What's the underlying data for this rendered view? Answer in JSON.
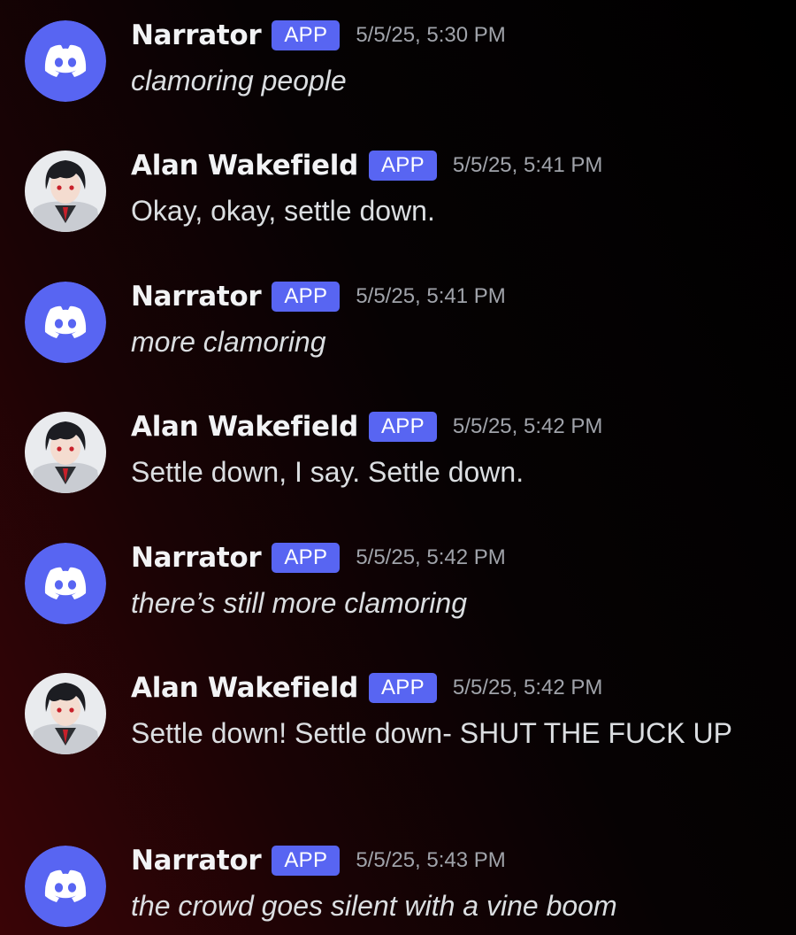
{
  "colors": {
    "badge": "#5865f2",
    "discord_avatar_bg": "#5865f2",
    "timestamp": "#a0a3aa",
    "message_text": "#dbdee1"
  },
  "messages": [
    {
      "username": "Narrator",
      "badge": "APP",
      "timestamp": "5/5/25, 5:30 PM",
      "text": "clamoring people",
      "italic": true,
      "avatar": "discord-logo-icon"
    },
    {
      "username": "Alan Wakefield",
      "badge": "APP",
      "timestamp": "5/5/25, 5:41 PM",
      "text": "Okay, okay, settle down.",
      "italic": false,
      "avatar": "anime-character-avatar"
    },
    {
      "username": "Narrator",
      "badge": "APP",
      "timestamp": "5/5/25, 5:41 PM",
      "text": "more clamoring",
      "italic": true,
      "avatar": "discord-logo-icon"
    },
    {
      "username": "Alan Wakefield",
      "badge": "APP",
      "timestamp": "5/5/25, 5:42 PM",
      "text": "Settle down, I say. Settle down.",
      "italic": false,
      "avatar": "anime-character-avatar"
    },
    {
      "username": "Narrator",
      "badge": "APP",
      "timestamp": "5/5/25, 5:42 PM",
      "text": "there’s still more clamoring",
      "italic": true,
      "avatar": "discord-logo-icon"
    },
    {
      "username": "Alan Wakefield",
      "badge": "APP",
      "timestamp": "5/5/25, 5:42 PM",
      "text": "Settle down! Settle down- SHUT THE FUCK UP",
      "italic": false,
      "avatar": "anime-character-avatar"
    },
    {
      "username": "Narrator",
      "badge": "APP",
      "timestamp": "5/5/25, 5:43 PM",
      "text": "the crowd goes silent with a vine boom",
      "italic": true,
      "avatar": "discord-logo-icon"
    }
  ]
}
